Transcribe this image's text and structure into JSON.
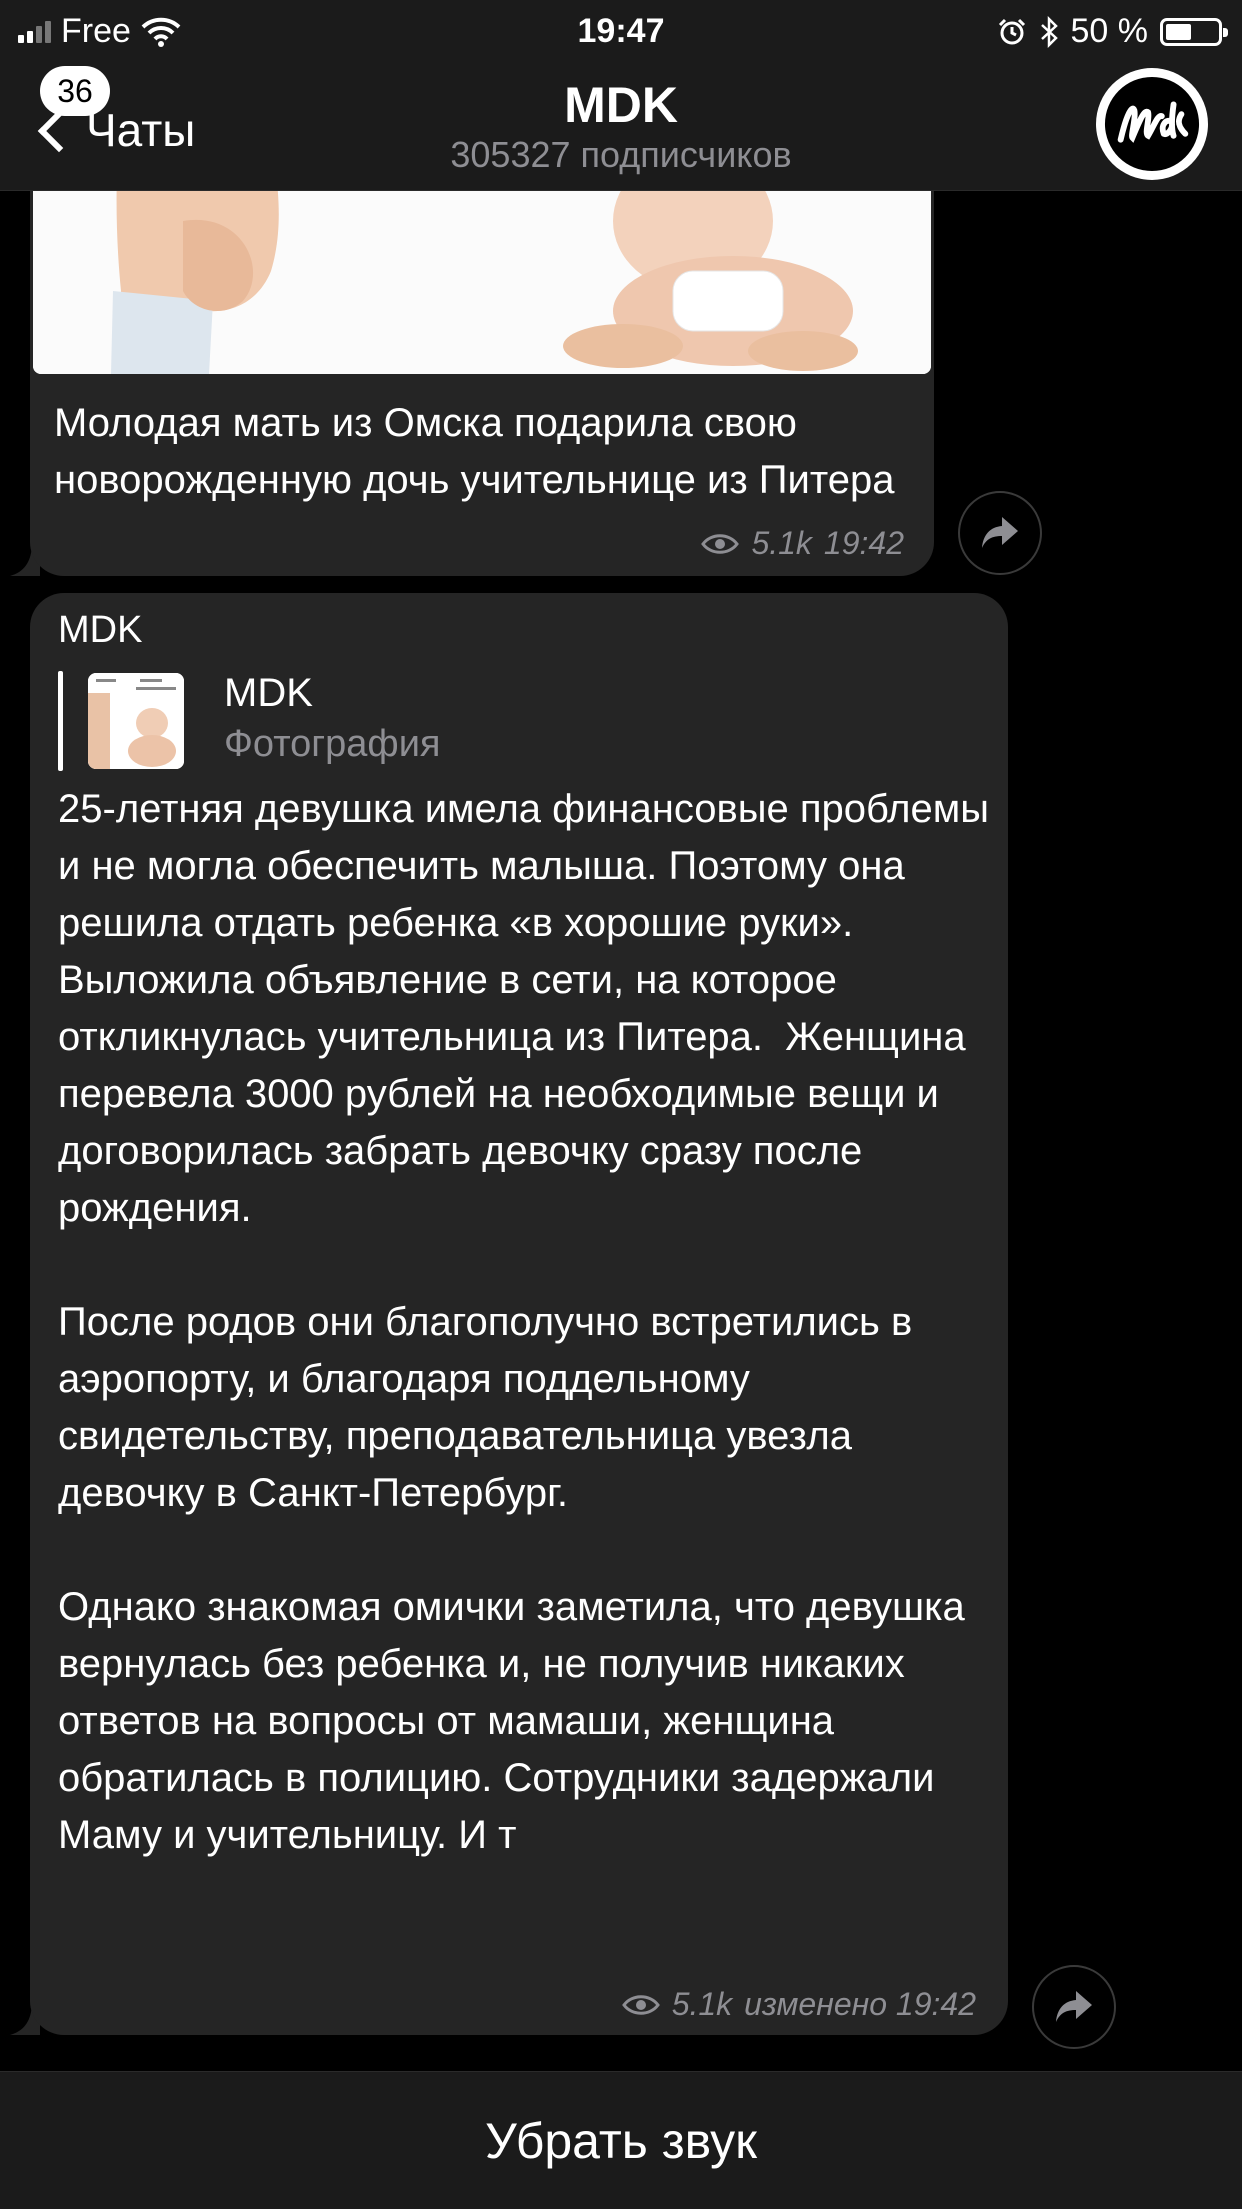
{
  "status_bar": {
    "carrier": "Free",
    "time": "19:47",
    "battery": "50 %",
    "battery_level": 0.5
  },
  "nav": {
    "back_label": "Чаты",
    "unread_count": "36",
    "title": "MDK",
    "subtitle": "305327 подписчиков",
    "avatar_icon": "mdk-logo-icon"
  },
  "messages": [
    {
      "text": "Молодая мать из Омска подарила свою новорожденную дочь учительнице из Питера",
      "views": "5.1k",
      "time": "19:42",
      "has_photo": true
    },
    {
      "author": "MDK",
      "reply": {
        "title": "MDK",
        "subtitle": "Фотография"
      },
      "text": "25-летняя девушка имела финансовые проблемы и не могла обеспечить малыша. Поэтому она решила отдать ребенка «в хорошие руки». Выложила объявление в сети, на которое откликнулась учительница из Питера.  Женщина перевела 3000 рублей на необходимые вещи и договорилась забрать девочку сразу после рождения.\n\nПосле родов они благополучно встретились в аэропорту, и благодаря поддельному свидетельству, преподавательница увезла девочку в Санкт-Петербург.\n\nОднако знакомая омички заметила, что девушка вернулась без ребенка и, не получив никаких ответов на вопросы от мамаши, женщина обратилась в полицию. Сотрудники задержали Маму и учительницу. И т",
      "views": "5.1k",
      "time": "изменено 19:42"
    }
  ],
  "bottom": {
    "mute_label": "Убрать звук"
  },
  "colors": {
    "background": "#000000",
    "bubble": "#252525",
    "bar": "#1b1b1b",
    "secondary_text": "#8e8e93"
  }
}
